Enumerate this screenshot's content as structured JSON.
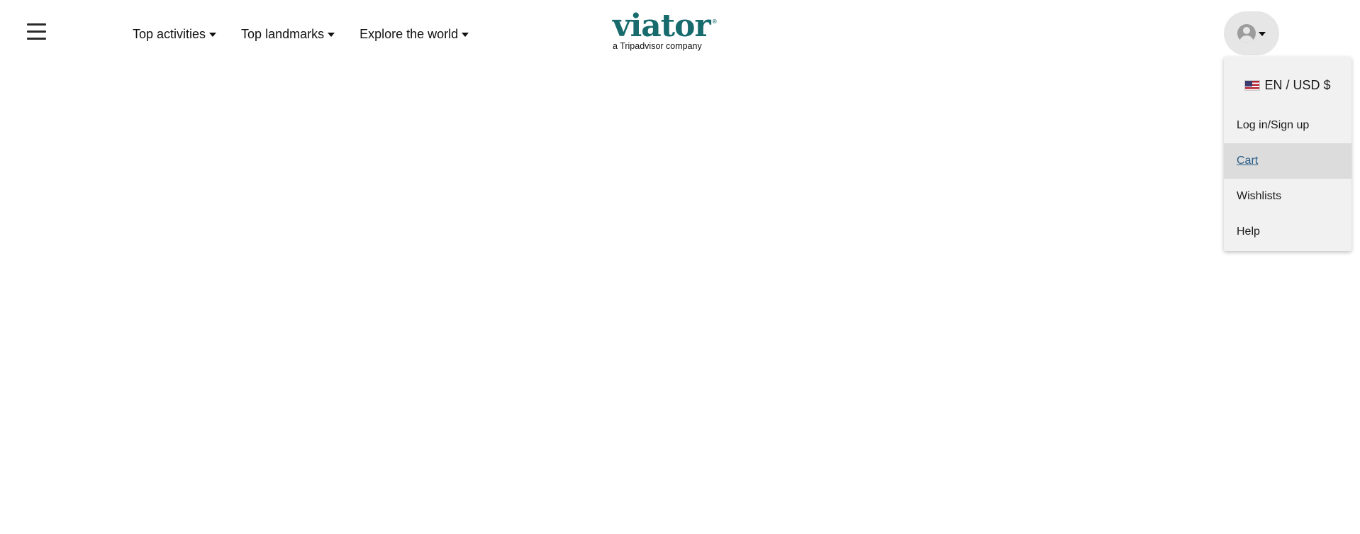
{
  "header": {
    "menu_icon": "hamburger-menu-icon",
    "nav": [
      {
        "label": "Top activities"
      },
      {
        "label": "Top landmarks"
      },
      {
        "label": "Explore the world"
      }
    ],
    "logo": {
      "wordmark": "viator",
      "registered": "®",
      "tagline": "a Tripadvisor company",
      "color": "#186b6d"
    },
    "account": {
      "avatar_icon": "user-avatar-icon",
      "caret_icon": "caret-down-icon"
    }
  },
  "account_menu": {
    "locale": {
      "flag_icon": "us-flag-icon",
      "label": "EN / USD $"
    },
    "items": [
      {
        "label": "Log in/Sign up"
      },
      {
        "label": "Cart",
        "active": true
      },
      {
        "label": "Wishlists"
      },
      {
        "label": "Help"
      }
    ]
  }
}
